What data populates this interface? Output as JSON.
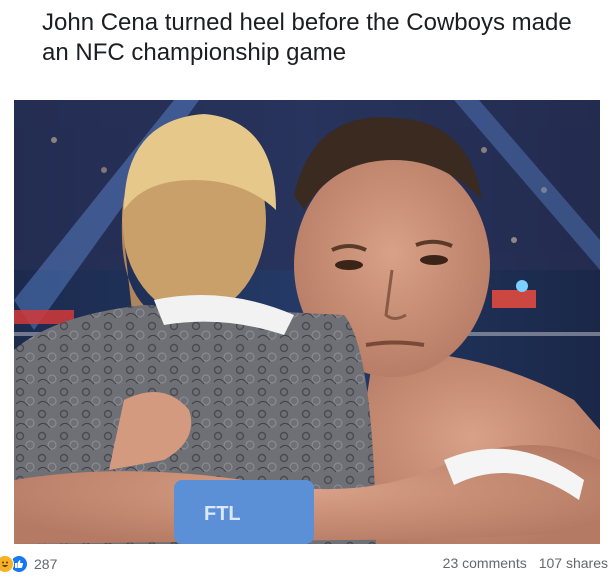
{
  "post": {
    "caption": "John Cena turned heel before the Cowboys made an NFC championship game"
  },
  "image": {
    "alt": "photo"
  },
  "footer": {
    "reaction_icons": [
      "haha-icon",
      "like-icon"
    ],
    "reaction_count": "287",
    "comments": "23 comments",
    "shares": "107 shares"
  },
  "colors": {
    "like_blue": "#1877f2",
    "haha_yellow": "#f7b125",
    "meta_gray": "#65676b",
    "caption_text": "#1c1e21"
  }
}
